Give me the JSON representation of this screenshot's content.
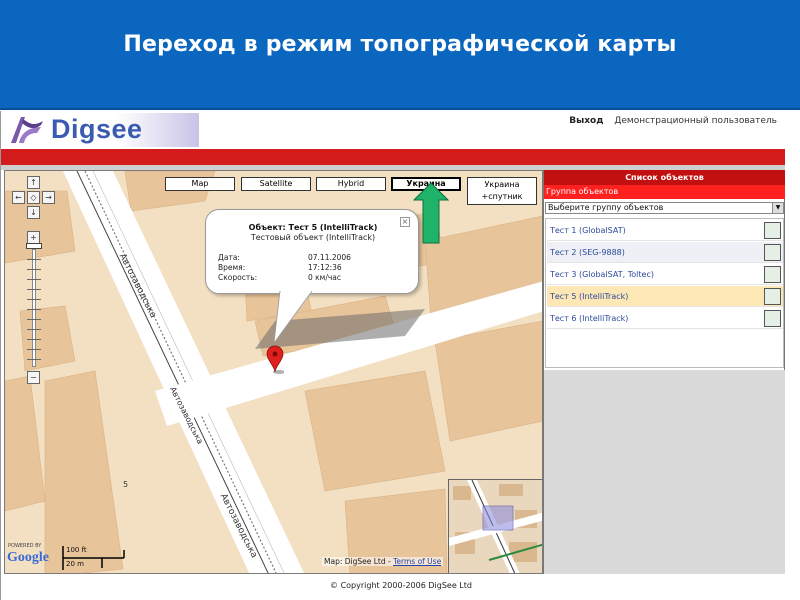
{
  "slide": {
    "title": "Переход в режим топографической карты"
  },
  "header": {
    "logo_text": "Digsee",
    "logout_label": "Выход",
    "user_label": "Демонстрационный пользователь"
  },
  "map": {
    "type_buttons": [
      {
        "label": "Map"
      },
      {
        "label": "Satellite"
      },
      {
        "label": "Hybrid"
      },
      {
        "label": "Украина"
      },
      {
        "label": "Украина\n+спутник"
      }
    ],
    "active_type": "Украина",
    "info_bubble": {
      "title": "Объект: Тест 5 (IntelliTrack)",
      "subtitle": "Тестовый объект (IntelliTrack)",
      "rows": [
        {
          "key": "Дата:",
          "value": "07.11.2006"
        },
        {
          "key": "Время:",
          "value": "17:12:36"
        },
        {
          "key": "Скорость:",
          "value": "0 км/час"
        }
      ]
    },
    "street_labels": [
      "Автозаводська",
      "Автозаводська",
      "Автозаводська"
    ],
    "block_number": "5",
    "copyright": "Map: DigSee Ltd - ",
    "terms_link": "Terms of Use",
    "powered_by": "POWERED BY",
    "google_text": "Google",
    "scale_top": "100 ft",
    "scale_bottom": "20 m",
    "nav_icons": [
      "pan-up-icon",
      "pan-left-icon",
      "pan-center-icon",
      "pan-right-icon",
      "pan-down-icon",
      "zoom-in-icon",
      "zoom-out-icon"
    ]
  },
  "panel": {
    "header": "Список объектов",
    "group_label": "Группа объектов",
    "group_select_value": "Выберите группу объектов",
    "objects": [
      {
        "label": "Тест 1 (GlobalSAT)",
        "selected": false
      },
      {
        "label": "Тест 2 (SEG-9888)",
        "selected": false
      },
      {
        "label": "Тест 3 (GlobalSAT, Toltec)",
        "selected": false
      },
      {
        "label": "Тест 5 (IntelliTrack)",
        "selected": true
      },
      {
        "label": "Тест 6 (IntelliTrack)",
        "selected": false
      }
    ]
  },
  "footer": {
    "copyright": "© Copyright 2000-2006 DigSee Ltd"
  },
  "colors": {
    "banner_blue": "#0b66c0",
    "header_red": "#d31b1b",
    "map_bg": "#f3dfc1",
    "road": "#ffffff",
    "building": "#e8c49a",
    "selected_row": "#fde7b5",
    "arrow_green": "#1fb36a"
  }
}
